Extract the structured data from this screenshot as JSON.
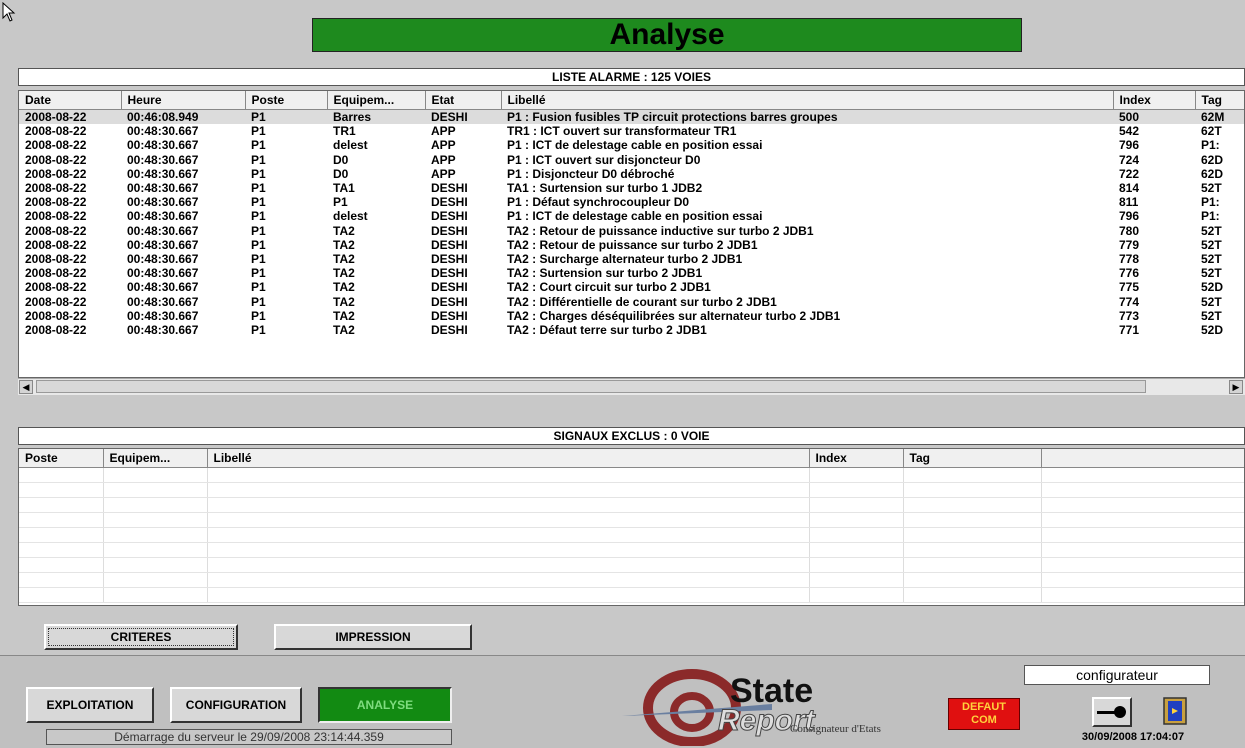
{
  "window_title": "Analyse",
  "alarm_list": {
    "header": "LISTE ALARME : 125 VOIES",
    "columns": [
      "Date",
      "Heure",
      "Poste",
      "Equipem...",
      "Etat",
      "Libellé",
      "Index",
      "Tag"
    ],
    "rows": [
      [
        "2008-08-22",
        "00:46:08.949",
        "P1",
        "Barres",
        "DESHI",
        "P1 : Fusion fusibles TP circuit protections barres groupes",
        "500",
        "62M"
      ],
      [
        "2008-08-22",
        "00:48:30.667",
        "P1",
        "TR1",
        "APP",
        "TR1 : ICT ouvert sur transformateur TR1",
        "542",
        "62T"
      ],
      [
        "2008-08-22",
        "00:48:30.667",
        "P1",
        "delest",
        "APP",
        "P1 : ICT de delestage cable en position essai",
        "796",
        "P1:"
      ],
      [
        "2008-08-22",
        "00:48:30.667",
        "P1",
        "D0",
        "APP",
        "P1 : ICT ouvert sur disjoncteur D0",
        "724",
        "62D"
      ],
      [
        "2008-08-22",
        "00:48:30.667",
        "P1",
        "D0",
        "APP",
        "P1 : Disjoncteur D0 débroché",
        "722",
        "62D"
      ],
      [
        "2008-08-22",
        "00:48:30.667",
        "P1",
        "TA1",
        "DESHI",
        "TA1 : Surtension sur turbo 1 JDB2",
        "814",
        "52T"
      ],
      [
        "2008-08-22",
        "00:48:30.667",
        "P1",
        "P1",
        "DESHI",
        "P1 : Défaut synchrocoupleur D0",
        "811",
        "P1:"
      ],
      [
        "2008-08-22",
        "00:48:30.667",
        "P1",
        "delest",
        "DESHI",
        "P1 : ICT de delestage cable en position essai",
        "796",
        "P1:"
      ],
      [
        "2008-08-22",
        "00:48:30.667",
        "P1",
        "TA2",
        "DESHI",
        "TA2 : Retour de puissance inductive sur turbo 2 JDB1",
        "780",
        "52T"
      ],
      [
        "2008-08-22",
        "00:48:30.667",
        "P1",
        "TA2",
        "DESHI",
        "TA2 : Retour de puissance sur turbo 2 JDB1",
        "779",
        "52T"
      ],
      [
        "2008-08-22",
        "00:48:30.667",
        "P1",
        "TA2",
        "DESHI",
        "TA2 : Surcharge alternateur turbo 2 JDB1",
        "778",
        "52T"
      ],
      [
        "2008-08-22",
        "00:48:30.667",
        "P1",
        "TA2",
        "DESHI",
        "TA2 : Surtension sur turbo 2 JDB1",
        "776",
        "52T"
      ],
      [
        "2008-08-22",
        "00:48:30.667",
        "P1",
        "TA2",
        "DESHI",
        "TA2 : Court circuit sur turbo 2 JDB1",
        "775",
        "52D"
      ],
      [
        "2008-08-22",
        "00:48:30.667",
        "P1",
        "TA2",
        "DESHI",
        "TA2 : Différentielle de courant sur turbo 2 JDB1",
        "774",
        "52T"
      ],
      [
        "2008-08-22",
        "00:48:30.667",
        "P1",
        "TA2",
        "DESHI",
        "TA2 : Charges déséquilibrées sur alternateur turbo 2 JDB1",
        "773",
        "52T"
      ],
      [
        "2008-08-22",
        "00:48:30.667",
        "P1",
        "TA2",
        "DESHI",
        "TA2 : Défaut terre sur turbo 2 JDB1",
        "771",
        "52D"
      ]
    ]
  },
  "excluded_list": {
    "header": "SIGNAUX EXCLUS : 0 VOIE",
    "columns": [
      "Poste",
      "Equipem...",
      "Libellé",
      "Index",
      "Tag",
      ""
    ]
  },
  "buttons": {
    "criteres": "CRITERES",
    "impression": "IMPRESSION",
    "exploitation": "EXPLOITATION",
    "configuration": "CONFIGURATION",
    "analyse": "ANALYSE"
  },
  "status": {
    "server_start": "Démarrage du serveur le 29/09/2008  23:14:44.359",
    "user": "configurateur",
    "datetime": "30/09/2008 17:04:07",
    "defaut_line1": "DEFAUT",
    "defaut_line2": "COM"
  },
  "logo": {
    "line1": "State",
    "line2": "Report",
    "subtitle": "Consignateur d'Etats"
  },
  "colors": {
    "title_green": "#1e8a1e",
    "analyse_green": "#128a12",
    "defaut_red": "#e01010"
  }
}
